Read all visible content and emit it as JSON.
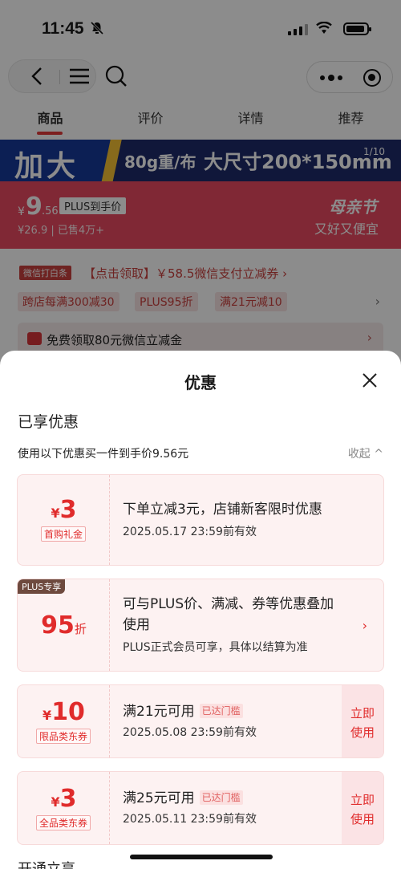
{
  "status_bar": {
    "time": "11:45"
  },
  "tabs": [
    {
      "label": "商品"
    },
    {
      "label": "评价"
    },
    {
      "label": "详情"
    },
    {
      "label": "推荐"
    }
  ],
  "banner": {
    "big_text": "加大",
    "mid_text": "80g重/布",
    "right_text": "大尺寸200*150mm",
    "page_indicator": "1/10"
  },
  "price": {
    "symbol": "¥",
    "integer": "9",
    "decimal": ".56",
    "plus_label": "PLUS到手价",
    "sub": "¥26.9 | 已售4万+",
    "promo_title": "母亲节",
    "promo_sub": "又好又便宜"
  },
  "wechat": {
    "tag": "微信打白条",
    "text": "【点击领取】￥58.5微信支付立减券 ›"
  },
  "discount_chips": [
    "跨店每满300减30",
    "PLUS95折",
    "满21元减10"
  ],
  "free_coupon": {
    "text": "免费领取80元微信立减金"
  },
  "sheet": {
    "title": "优惠",
    "section_title": "已享优惠",
    "summary": "使用以下优惠买一件到手价9.56元",
    "collapse": "收起 ^"
  },
  "cards": [
    {
      "symbol": "¥",
      "amount": "3",
      "unit": "",
      "badge": "首购礼金",
      "title": "下单立减3元，店铺新客限时优惠",
      "date": "2025.05.17 23:59前有效"
    },
    {
      "corner": "PLUS专享",
      "amount": "95",
      "unit": "折",
      "title": "可与PLUS价、满减、券等优惠叠加使用",
      "desc": "PLUS正式会员可享，具体以结算为准",
      "arrow": "›"
    },
    {
      "symbol": "¥",
      "amount": "10",
      "badge": "限品类东券",
      "title": "满21元可用",
      "threshold": "已达门槛",
      "date": "2025.05.08 23:59前有效",
      "button": [
        "立即",
        "使用"
      ]
    },
    {
      "symbol": "¥",
      "amount": "3",
      "badge": "全品类东券",
      "title": "满25元可用",
      "threshold": "已达门槛",
      "date": "2025.05.11 23:59前有效",
      "button": [
        "立即",
        "使用"
      ]
    }
  ],
  "next_section": "开通立享",
  "colors": {
    "accent": "#e02b2b",
    "card_bg": "#fdf2f2",
    "price_bar": "#e94961"
  }
}
